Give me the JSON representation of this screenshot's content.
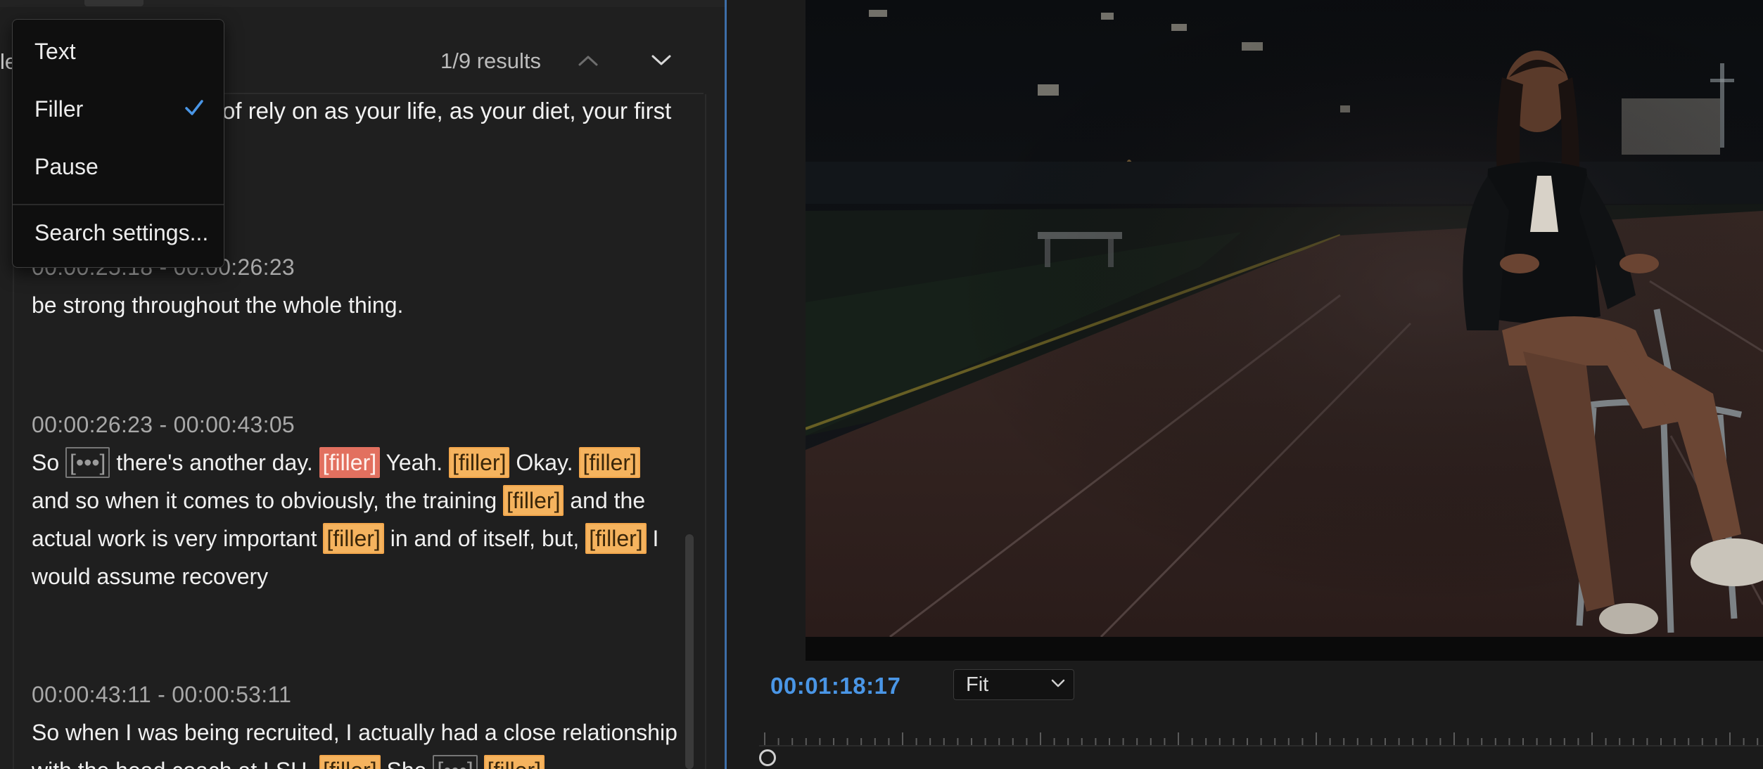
{
  "search": {
    "edge_fragment": "le",
    "results_count": "1/9 results"
  },
  "dropdown": {
    "items": [
      {
        "label": "Text",
        "checked": false
      },
      {
        "label": "Filler",
        "checked": true
      },
      {
        "label": "Pause",
        "checked": false
      },
      {
        "label": "Search settings..."
      }
    ]
  },
  "transcript": {
    "partial_line": "of rely on as your life, as your diet, your first",
    "segments": [
      {
        "timestamp": "00:00:25:18 - 00:00:26:23",
        "text": "be strong throughout the whole thing."
      },
      {
        "timestamp": "00:00:26:23 - 00:00:43:05",
        "parts": [
          {
            "t": "So "
          },
          {
            "tag": "pause",
            "t": "[•••]"
          },
          {
            "t": " there's another day. "
          },
          {
            "tag": "filler-active",
            "t": "[filler]"
          },
          {
            "t": " Yeah. "
          },
          {
            "tag": "filler",
            "t": "[filler]"
          },
          {
            "t": " Okay. "
          },
          {
            "tag": "filler",
            "t": "[filler]"
          },
          {
            "t": " and so when it comes to obviously, the training "
          },
          {
            "tag": "filler",
            "t": "[filler]"
          },
          {
            "t": " and the actual work is very important "
          },
          {
            "tag": "filler",
            "t": "[filler]"
          },
          {
            "t": " in and of itself, but, "
          },
          {
            "tag": "filler",
            "t": "[filler]"
          },
          {
            "t": " I would assume recovery"
          }
        ]
      },
      {
        "timestamp": "00:00:43:11 - 00:00:53:11",
        "parts": [
          {
            "t": "So when I was being recruited, I actually had a close relationship with the head coach at LSU. "
          },
          {
            "tag": "filler",
            "t": "[filler]"
          },
          {
            "t": " She "
          },
          {
            "tag": "pause",
            "t": "[•••]"
          },
          {
            "t": " "
          },
          {
            "tag": "filler",
            "t": "[filler]"
          }
        ]
      }
    ]
  },
  "monitor": {
    "timecode": "00:01:18:17",
    "fit_label": "Fit"
  },
  "colors": {
    "accent": "#4a96e6",
    "filler": "#f5b35e",
    "filler_active": "#e2705f"
  }
}
